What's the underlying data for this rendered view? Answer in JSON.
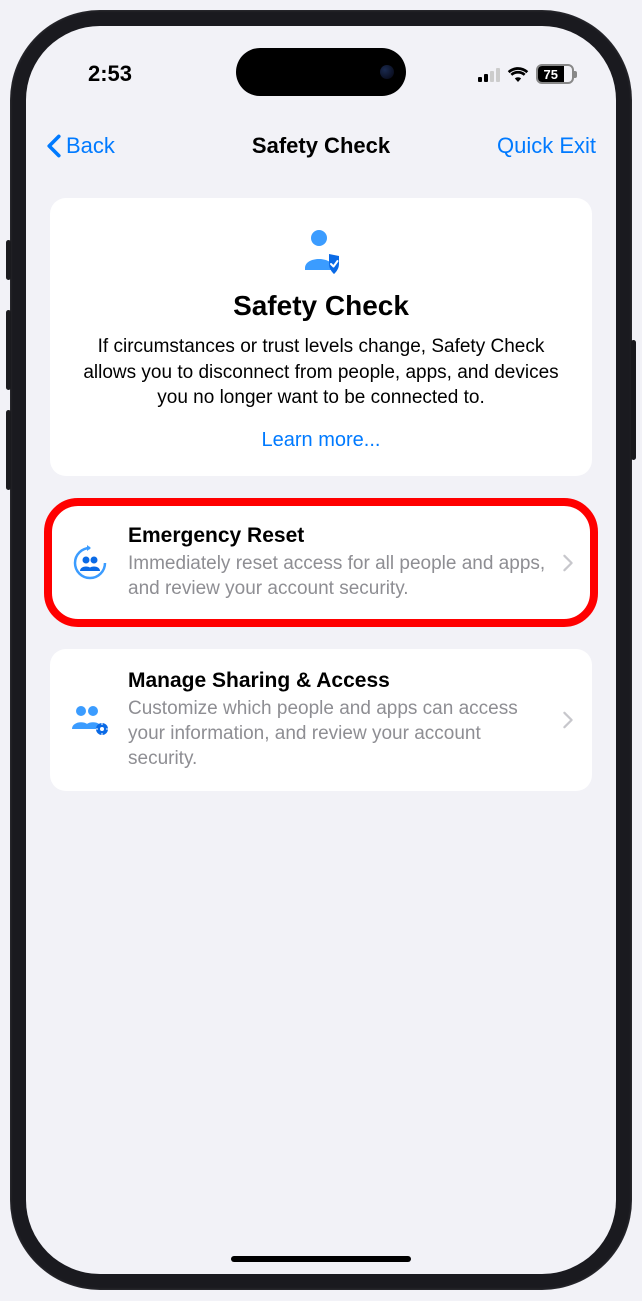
{
  "status": {
    "time": "2:53",
    "battery_level": "75"
  },
  "nav": {
    "back_label": "Back",
    "title": "Safety Check",
    "quick_exit": "Quick Exit"
  },
  "hero": {
    "title": "Safety Check",
    "description": "If circumstances or trust levels change, Safety Check allows you to disconnect from people, apps, and devices you no longer want to be connected to.",
    "learn_more": "Learn more..."
  },
  "options": [
    {
      "title": "Emergency Reset",
      "description": "Immediately reset access for all people and apps, and review your account security."
    },
    {
      "title": "Manage Sharing & Access",
      "description": "Customize which people and apps can access your information, and review your account security."
    }
  ]
}
